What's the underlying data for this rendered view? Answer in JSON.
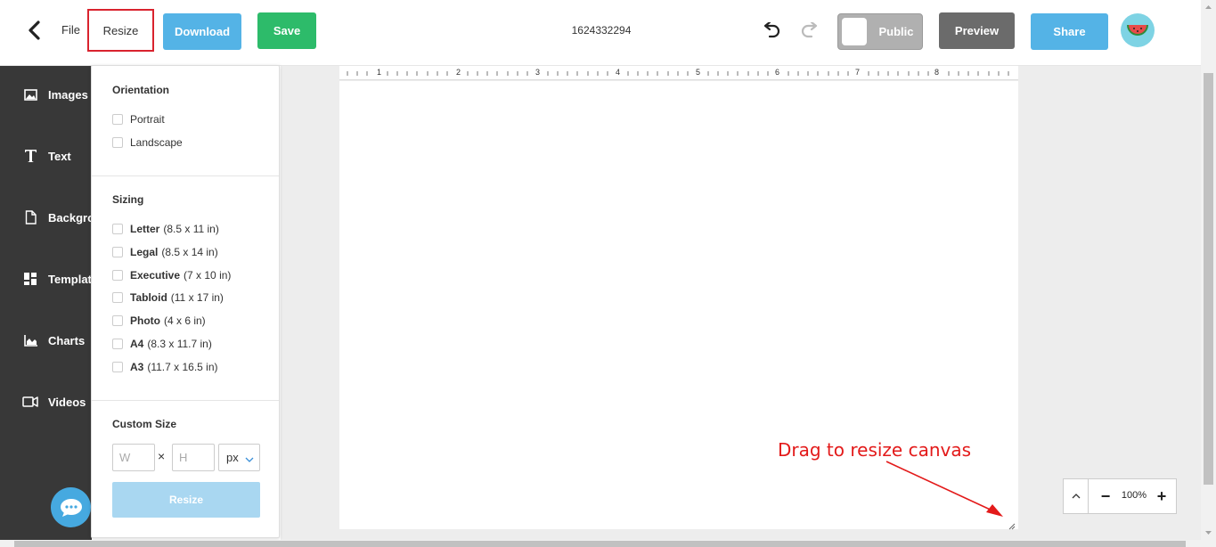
{
  "header": {
    "file_label": "File",
    "resize_label": "Resize",
    "download_label": "Download",
    "save_label": "Save",
    "doc_title": "1624332294",
    "public_label": "Public",
    "preview_label": "Preview",
    "share_label": "Share"
  },
  "sidebar": {
    "items": [
      {
        "label": "Images",
        "icon": "image-icon"
      },
      {
        "label": "Text",
        "icon": "text-icon"
      },
      {
        "label": "Backgrou",
        "icon": "file-icon"
      },
      {
        "label": "Template",
        "icon": "grid-icon"
      },
      {
        "label": "Charts",
        "icon": "chart-icon"
      },
      {
        "label": "Videos",
        "icon": "video-icon"
      }
    ]
  },
  "resize_panel": {
    "orientation_heading": "Orientation",
    "orientations": [
      "Portrait",
      "Landscape"
    ],
    "sizing_heading": "Sizing",
    "sizes": [
      {
        "name": "Letter",
        "dims": "(8.5 x 11 in)"
      },
      {
        "name": "Legal",
        "dims": "(8.5 x 14 in)"
      },
      {
        "name": "Executive",
        "dims": "(7 x 10 in)"
      },
      {
        "name": "Tabloid",
        "dims": "(11 x 17 in)"
      },
      {
        "name": "Photo",
        "dims": "(4 x 6 in)"
      },
      {
        "name": "A4",
        "dims": "(8.3 x 11.7 in)"
      },
      {
        "name": "A3",
        "dims": "(11.7 x 16.5 in)"
      }
    ],
    "custom_heading": "Custom Size",
    "width_placeholder": "W",
    "times_symbol": "×",
    "height_placeholder": "H",
    "unit_value": "px",
    "resize_button": "Resize"
  },
  "ruler": {
    "numbers": [
      "1",
      "2",
      "3",
      "4",
      "5",
      "6",
      "7",
      "8"
    ]
  },
  "annotation": {
    "text": "Drag to resize canvas",
    "color": "#e31a1a"
  },
  "zoom": {
    "value": "100%",
    "minus": "−",
    "plus": "+"
  },
  "colors": {
    "download": "#54b3e6",
    "save": "#2dbb6a",
    "preview": "#6b6b6b",
    "share": "#54b3e6",
    "sidebar": "#383838",
    "chat": "#46a9e0"
  }
}
